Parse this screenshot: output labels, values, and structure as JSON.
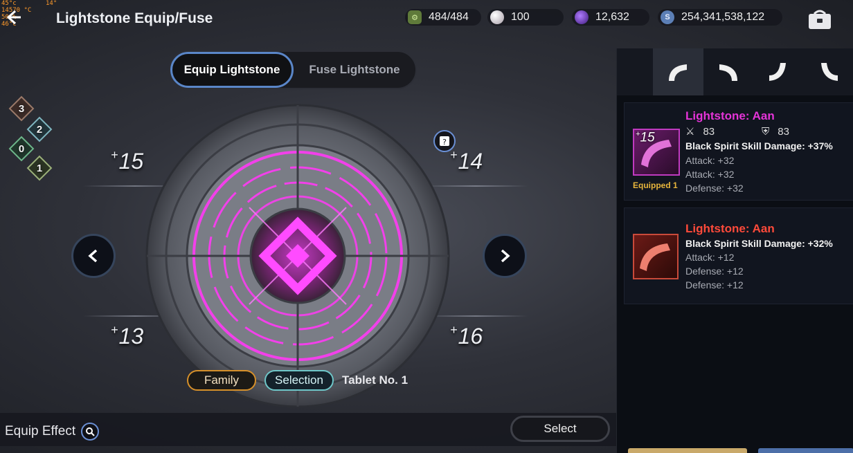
{
  "overlay": {
    "line1": "45°c",
    "line2": "14570 °C",
    "line3": "50 %",
    "line4": "46°c",
    "right": "14°"
  },
  "header": {
    "title": "Lightstone Equip/Fuse"
  },
  "currencies": {
    "energy": "484/484",
    "pearl": "100",
    "purple": "12,632",
    "silver": "254,341,538,122",
    "silver_icon_label": "S"
  },
  "tabs": {
    "equip": "Equip Lightstone",
    "fuse": "Fuse Lightstone"
  },
  "family_counts": [
    "3",
    "2",
    "0",
    "1"
  ],
  "slots": {
    "top_left": "15",
    "top_right": "14",
    "bottom_left": "13",
    "bottom_right": "16",
    "plus": "+"
  },
  "tags": {
    "family": "Family",
    "selection": "Selection",
    "tablet": "Tablet No. 1"
  },
  "footer": {
    "equip_effect": "Equip Effect",
    "select": "Select"
  },
  "items": [
    {
      "level": "15",
      "equipped": "Equipped 1",
      "name": "Lightstone: Aan",
      "stat_attack": "83",
      "stat_defense": "83",
      "main": "Black Spirit Skill Damage: +37%",
      "subs": [
        "Attack: +32",
        "Attack: +32",
        "Defense: +32"
      ]
    },
    {
      "name": "Lightstone: Aan",
      "main": "Black Spirit Skill Damage: +32%",
      "subs": [
        "Attack: +12",
        "Defense: +12",
        "Defense: +12"
      ]
    }
  ],
  "colors": {
    "accent": "#5a86c8",
    "magenta": "#e534d8",
    "red": "#ff4a3a",
    "gold": "#e7b53c"
  }
}
